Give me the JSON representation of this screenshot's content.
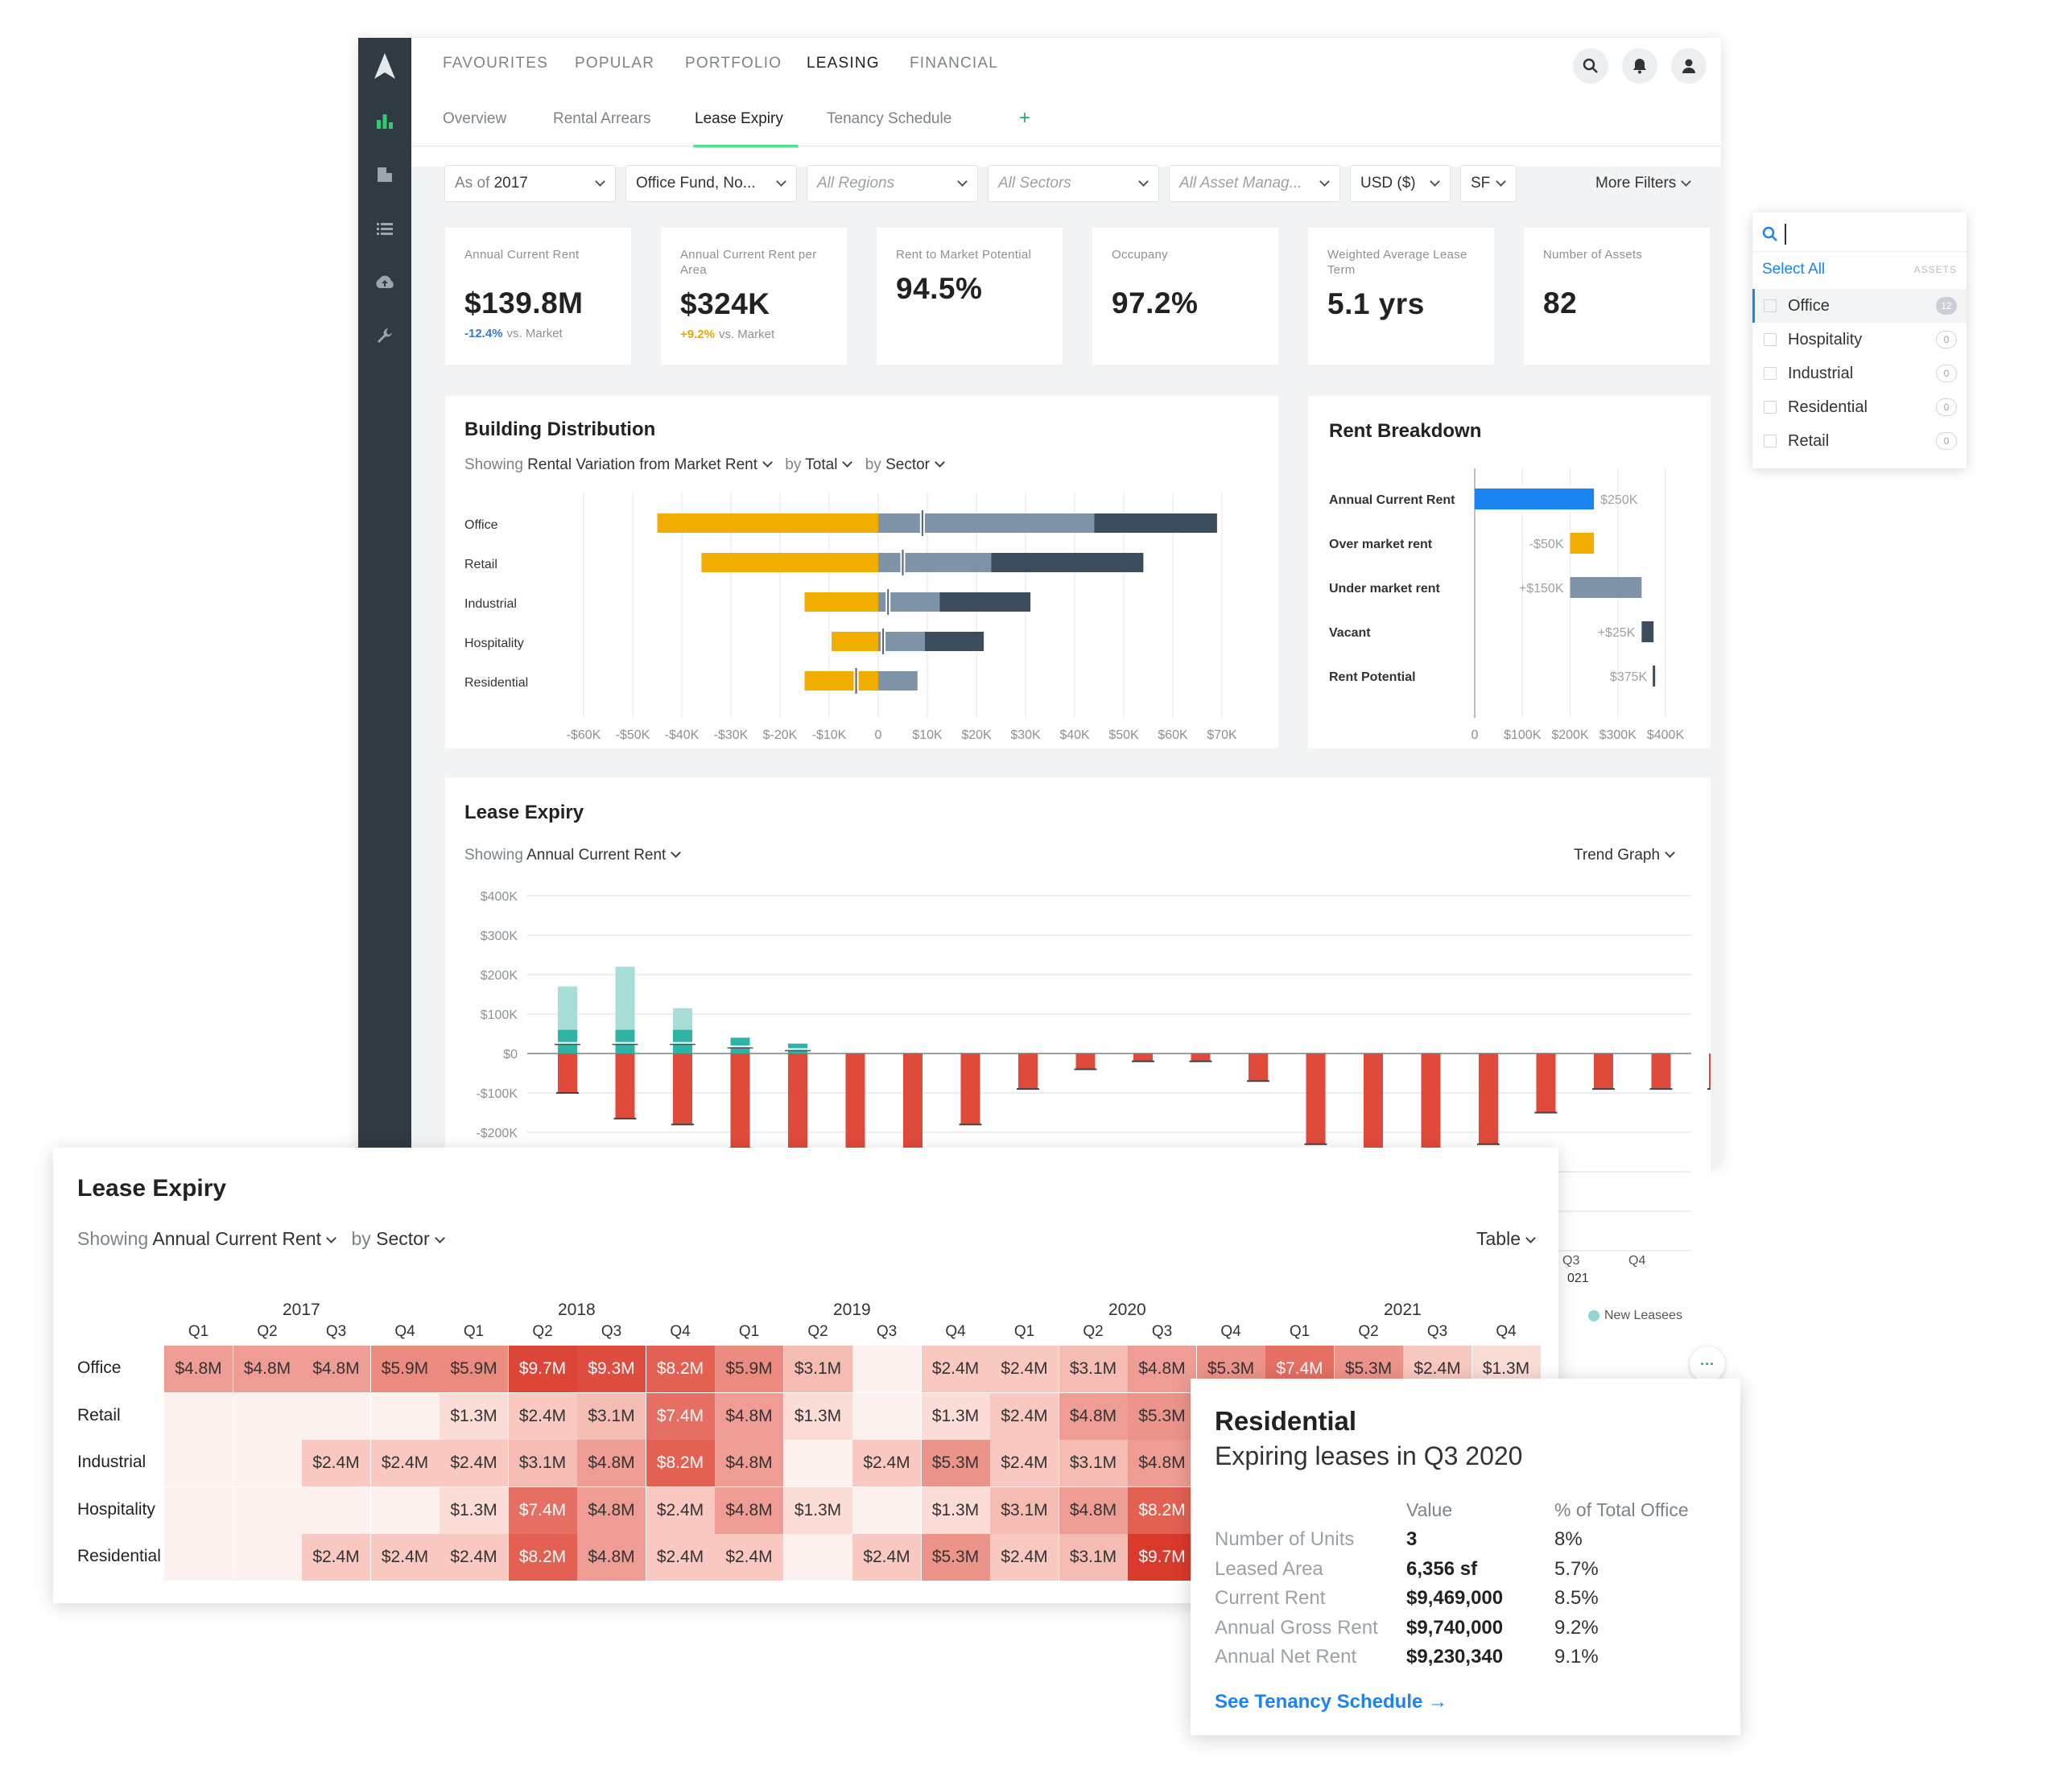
{
  "nav": {
    "top": [
      "FAVOURITES",
      "POPULAR",
      "PORTFOLIO",
      "LEASING",
      "FINANCIAL"
    ],
    "active_top": "LEASING",
    "tabs": [
      "Overview",
      "Rental Arrears",
      "Lease Expiry",
      "Tenancy Schedule"
    ],
    "active_tab": "Lease Expiry",
    "add_tab": "+"
  },
  "filters": {
    "as_of_prefix": "As of",
    "as_of": "2017",
    "fund": "Office Fund, No...",
    "regions": "All Regions",
    "sectors": "All Sectors",
    "managers": "All Asset Manag...",
    "currency": "USD ($)",
    "unit": "SF",
    "more": "More Filters"
  },
  "kpis": [
    {
      "label": "Annual Current Rent",
      "value": "$139.8M",
      "delta": "-12.4%",
      "delta_suffix": "vs. Market",
      "delta_color": "#3a7bc8"
    },
    {
      "label": "Annual Current Rent per Area",
      "value": "$324K",
      "delta": "+9.2%",
      "delta_suffix": "vs. Market",
      "delta_color": "#f0a500"
    },
    {
      "label": "Rent to Market Potential",
      "value": "94.5%"
    },
    {
      "label": "Occupany",
      "value": "97.2%"
    },
    {
      "label": "Weighted Average Lease Term",
      "value": "5.1 yrs"
    },
    {
      "label": "Number of Assets",
      "value": "82"
    }
  ],
  "building_distribution": {
    "title": "Building Distribution",
    "showing_prefix": "Showing",
    "showing": "Rental Variation from Market Rent",
    "by1_prefix": "by",
    "by1": "Total",
    "by2_prefix": "by",
    "by2": "Sector"
  },
  "rent_breakdown": {
    "title": "Rent Breakdown"
  },
  "lease_expiry_trend": {
    "title": "Lease Expiry",
    "showing_prefix": "Showing",
    "showing": "Annual Current Rent",
    "view": "Trend Graph",
    "legend": "New Leasees",
    "partial_year": "021",
    "partial_quarters": [
      "Q3",
      "Q4"
    ]
  },
  "chart_data": [
    {
      "type": "bar",
      "orientation": "horizontal",
      "categories": [
        "Office",
        "Retail",
        "Industrial",
        "Hospitality",
        "Residential"
      ],
      "series": [
        {
          "values": [
            -45000,
            -36000,
            -15000,
            -9500,
            -15000
          ],
          "color": "#f2ae00"
        },
        {
          "values": [
            44000,
            23000,
            12500,
            9500,
            8000
          ],
          "color": "#7f93a8"
        },
        {
          "values": [
            25000,
            31000,
            18500,
            12000,
            0
          ],
          "color": "#3c4c5c"
        }
      ],
      "marker_values": [
        9000,
        5000,
        2000,
        1000,
        -4500
      ],
      "xlim": [
        -60000,
        70000
      ],
      "ticks": [
        "-$60K",
        "-$50K",
        "-$40K",
        "-$30K",
        "$-20K",
        "-$10K",
        "0",
        "$10K",
        "$20K",
        "$30K",
        "$40K",
        "$50K",
        "$60K",
        "$70K"
      ]
    },
    {
      "type": "bar",
      "orientation": "horizontal",
      "categories": [
        "Annual Current Rent",
        "Over market rent",
        "Under market rent",
        "Vacant",
        "Rent Potential"
      ],
      "start": [
        0,
        250000,
        200000,
        350000,
        375000
      ],
      "end": [
        250000,
        200000,
        350000,
        375000,
        375000
      ],
      "value_labels": [
        "$250K",
        "-$50K",
        "+$150K",
        "+$25K",
        "$375K"
      ],
      "colors": [
        "#1a85f0",
        "#f2ae00",
        "#7f93a8",
        "#3c4c5c",
        "#3c4c5c"
      ],
      "xlim": [
        0,
        400000
      ],
      "ticks": [
        "0",
        "$100K",
        "$200K",
        "$300K",
        "$400K"
      ]
    },
    {
      "type": "bar",
      "title": "Lease Expiry",
      "y_ticks": [
        "$400K",
        "$300K",
        "$200K",
        "$100K",
        "$0",
        "-$100K",
        "-$200K"
      ],
      "ylim": [
        -200000,
        400000
      ],
      "series": [
        {
          "name": "New Leasees",
          "values": [
            170000,
            220000,
            115000,
            40000,
            25000,
            0,
            0,
            0,
            0,
            0,
            0,
            0,
            0,
            0,
            0,
            0,
            0,
            0,
            0,
            0,
            0
          ],
          "color": "#a8ddd8"
        },
        {
          "values": [
            -100000,
            -165000,
            -180000,
            -240000,
            -280000,
            -300000,
            -300000,
            -180000,
            -90000,
            -40000,
            -20000,
            -20000,
            -70000,
            -230000,
            -300000,
            -300000,
            -230000,
            -150000,
            -90000,
            -90000,
            -90000
          ],
          "color": "#e04a3b"
        }
      ]
    }
  ],
  "lease_expiry_table": {
    "title": "Lease Expiry",
    "showing_prefix": "Showing",
    "showing": "Annual Current Rent",
    "by_prefix": "by",
    "by": "Sector",
    "view": "Table",
    "years": [
      "2017",
      "2018",
      "2019",
      "2020",
      "2021"
    ],
    "quarters": [
      "Q1",
      "Q2",
      "Q3",
      "Q4"
    ],
    "rows": [
      {
        "label": "Office",
        "cells": [
          "$4.8M",
          "$4.8M",
          "$4.8M",
          "$5.9M",
          "$5.9M",
          "$9.7M",
          "$9.3M",
          "$8.2M",
          "$5.9M",
          "$3.1M",
          "",
          "$2.4M",
          "$2.4M",
          "$3.1M",
          "$4.8M",
          "$5.3M",
          "$7.4M",
          "$5.3M",
          "$2.4M",
          "$1.3M"
        ]
      },
      {
        "label": "Retail",
        "cells": [
          "",
          "",
          "",
          "",
          "$1.3M",
          "$2.4M",
          "$3.1M",
          "$7.4M",
          "$4.8M",
          "$1.3M",
          "",
          "$1.3M",
          "$2.4M",
          "$4.8M",
          "$5.3M",
          "",
          "",
          "",
          "",
          ""
        ]
      },
      {
        "label": "Industrial",
        "cells": [
          "",
          "",
          "$2.4M",
          "$2.4M",
          "$2.4M",
          "$3.1M",
          "$4.8M",
          "$8.2M",
          "$4.8M",
          "",
          "$2.4M",
          "$5.3M",
          "$2.4M",
          "$3.1M",
          "$4.8M",
          "",
          "",
          "",
          "",
          ""
        ]
      },
      {
        "label": "Hospitality",
        "cells": [
          "",
          "",
          "",
          "",
          "$1.3M",
          "$7.4M",
          "$4.8M",
          "$2.4M",
          "$4.8M",
          "$1.3M",
          "",
          "$1.3M",
          "$3.1M",
          "$4.8M",
          "$8.2M",
          "",
          "",
          "",
          "",
          ""
        ]
      },
      {
        "label": "Residential",
        "cells": [
          "",
          "",
          "$2.4M",
          "$2.4M",
          "$2.4M",
          "$8.2M",
          "$4.8M",
          "$2.4M",
          "$2.4M",
          "",
          "$2.4M",
          "$5.3M",
          "$2.4M",
          "$3.1M",
          "$9.7M",
          "",
          "",
          "",
          "",
          ""
        ]
      }
    ]
  },
  "sector_menu": {
    "select_all": "Select All",
    "assets_label": "ASSETS",
    "items": [
      {
        "label": "Office",
        "count": "12"
      },
      {
        "label": "Hospitality",
        "count": "0"
      },
      {
        "label": "Industrial",
        "count": "0"
      },
      {
        "label": "Residential",
        "count": "0"
      },
      {
        "label": "Retail",
        "count": "0"
      }
    ]
  },
  "popover": {
    "title": "Residential",
    "subtitle": "Expiring leases in Q3 2020",
    "col_value": "Value",
    "col_pct": "% of Total Office",
    "rows": [
      {
        "k": "Number of Units",
        "v": "3",
        "p": "8%"
      },
      {
        "k": "Leased Area",
        "v": "6,356 sf",
        "p": "5.7%"
      },
      {
        "k": "Current Rent",
        "v": "$9,469,000",
        "p": "8.5%"
      },
      {
        "k": "Annual Gross Rent",
        "v": "$9,740,000",
        "p": "9.2%"
      },
      {
        "k": "Annual Net Rent",
        "v": "$9,230,340",
        "p": "9.1%"
      }
    ],
    "link": "See Tenancy Schedule →"
  },
  "more_label": "···"
}
